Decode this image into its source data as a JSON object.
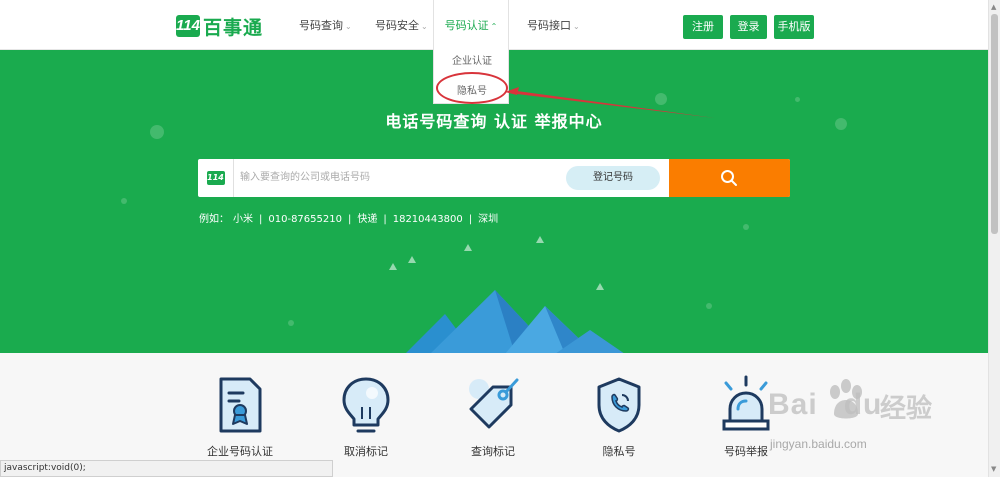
{
  "header": {
    "logo_number": "114",
    "logo_text": "百事通",
    "nav": [
      {
        "label": "号码查询",
        "chevron": "⌄"
      },
      {
        "label": "号码安全",
        "chevron": "⌄"
      },
      {
        "label": "号码认证",
        "chevron": "⌃"
      },
      {
        "label": "号码接口",
        "chevron": "⌄"
      }
    ],
    "buttons": {
      "register": "注册",
      "login": "登录",
      "mobile": "手机版"
    }
  },
  "dropdown": {
    "items": [
      "企业认证",
      "隐私号"
    ]
  },
  "hero": {
    "title": "电话号码查询  认证  举报中心",
    "search": {
      "logo": "114",
      "placeholder": "输入要查询的公司或电话号码",
      "register_label": "登记号码"
    },
    "examples": {
      "prefix": "例如：",
      "items": [
        "小米",
        "010-87655210",
        "快递",
        "18210443800",
        "深圳"
      ],
      "separator": "|"
    }
  },
  "services": [
    {
      "label": "企业号码认证",
      "icon": "certificate-icon"
    },
    {
      "label": "取消标记",
      "icon": "lightbulb-icon"
    },
    {
      "label": "查询标记",
      "icon": "tag-icon"
    },
    {
      "label": "隐私号",
      "icon": "shield-phone-icon"
    },
    {
      "label": "号码举报",
      "icon": "alarm-icon"
    }
  ],
  "status_bar": "javascript:void(0);",
  "watermark": {
    "brand": "Bai",
    "brand2": "du",
    "cn": "经验",
    "url": "jingyan.baidu.com"
  },
  "colors": {
    "primary": "#1aab4e",
    "search_button": "#fa7d00",
    "highlight_circle": "#d8343b",
    "register_pill": "#d6eef5"
  }
}
